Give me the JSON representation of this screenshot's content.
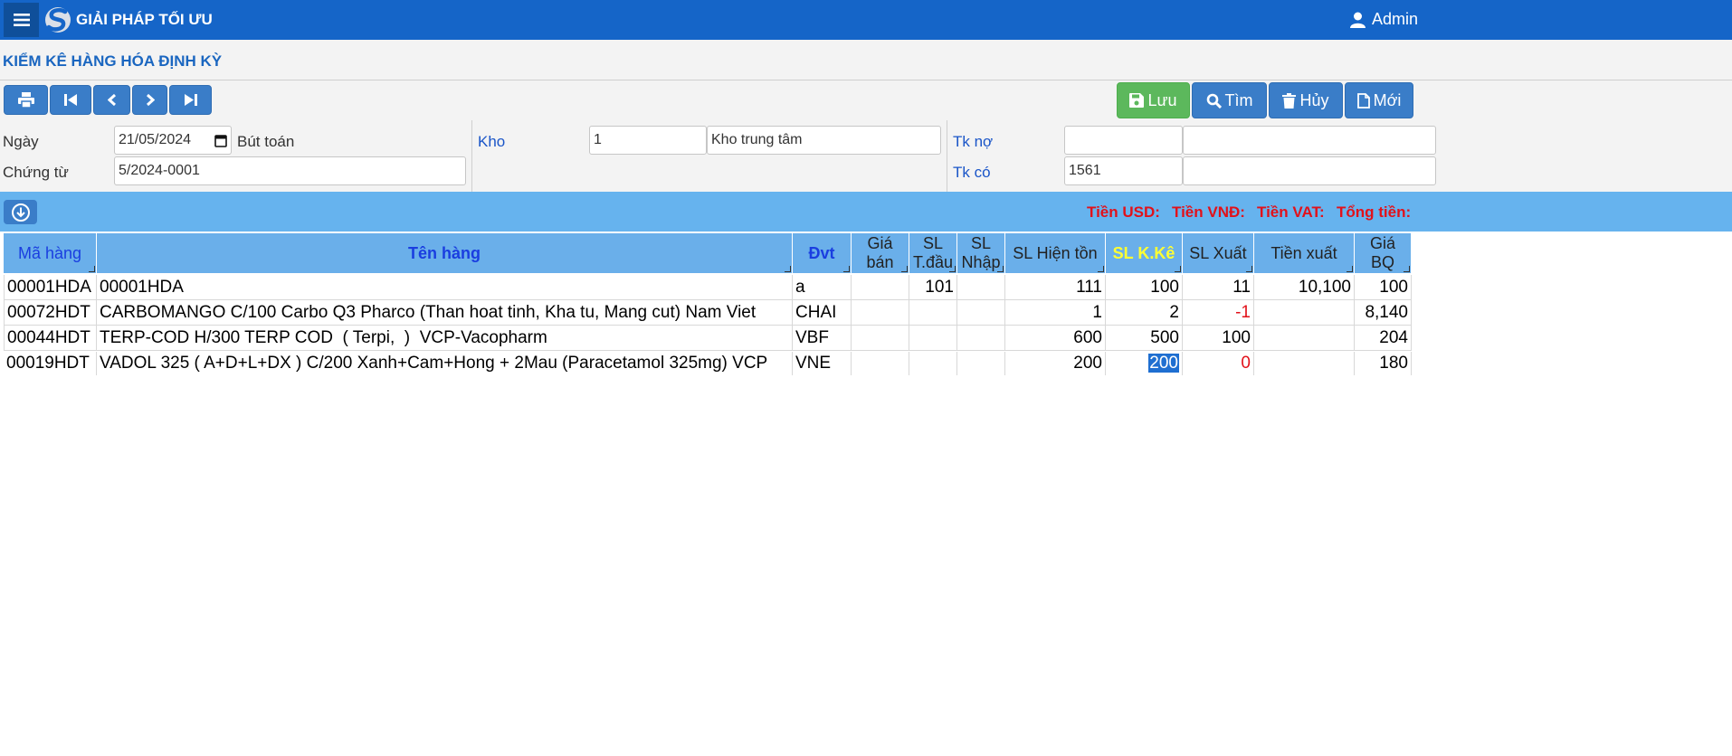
{
  "header": {
    "brand": "GIẢI PHÁP TỐI ƯU",
    "user": "Admin",
    "menu_icon": "hamburger-icon",
    "user_icon": "user-icon"
  },
  "page": {
    "title": "KIỂM KÊ HÀNG HÓA ĐỊNH KỲ"
  },
  "toolbar": {
    "nav_icons": [
      "print-icon",
      "first-icon",
      "prev-icon",
      "next-icon",
      "last-icon"
    ],
    "save_label": "Lưu",
    "find_label": "Tìm",
    "cancel_label": "Hủy",
    "new_label": "Mới"
  },
  "form": {
    "date_label": "Ngày",
    "date_value": "21/05/2024",
    "journal_label": "Bút toán",
    "voucher_label": "Chứng từ",
    "voucher_value": "5/2024-0001",
    "warehouse_label": "Kho",
    "warehouse_code": "1",
    "warehouse_name": "Kho trung tâm",
    "debit_label": "Tk nợ",
    "debit_value": "",
    "debit_name": "",
    "credit_label": "Tk có",
    "credit_value": "1561",
    "credit_name": ""
  },
  "totals": {
    "usd": "Tiền USD:",
    "vnd": "Tiền VNĐ:",
    "vat": "Tiền VAT:",
    "total": "Tổng tiền:"
  },
  "table": {
    "headers": [
      "Mã hàng",
      "Tên hàng",
      "Đvt",
      "Giá bán",
      "SL T.đầu",
      "SL Nhập",
      "SL Hiện tồn",
      "SL K.Kê",
      "SL Xuất",
      "Tiền xuất",
      "Giá BQ"
    ],
    "rows": [
      [
        "00001HDA",
        "00001HDA",
        "a",
        "",
        "101",
        "",
        "111",
        "100",
        "11",
        "10,100",
        "100"
      ],
      [
        "00072HDT",
        "CARBOMANGO C/100 Carbo Q3 Pharco (Than hoat tinh, Kha tu, Mang cut) Nam Viet",
        "CHAI",
        "",
        "",
        "",
        "1",
        "2",
        "-1",
        "",
        "8,140"
      ],
      [
        "00044HDT",
        "TERP-COD H/300 TERP COD  ( Terpi,  )  VCP-Vacopharm",
        "VBF",
        "",
        "",
        "",
        "600",
        "500",
        "100",
        "",
        "204"
      ],
      [
        "00019HDT",
        "VADOL 325 ( A+D+L+DX ) C/200 Xanh+Cam+Hong + 2Mau (Paracetamol 325mg) VCP",
        "VNE",
        "",
        "",
        "",
        "200",
        "200",
        "0",
        "",
        "180"
      ]
    ]
  },
  "colors": {
    "topbar": "#1565c8",
    "title": "#1a66c0",
    "header_bg": "#6aafea",
    "strip": "#66b3ee",
    "save": "#5cb85c",
    "negative": "#e2111a",
    "kk_header": "#ffff33"
  }
}
